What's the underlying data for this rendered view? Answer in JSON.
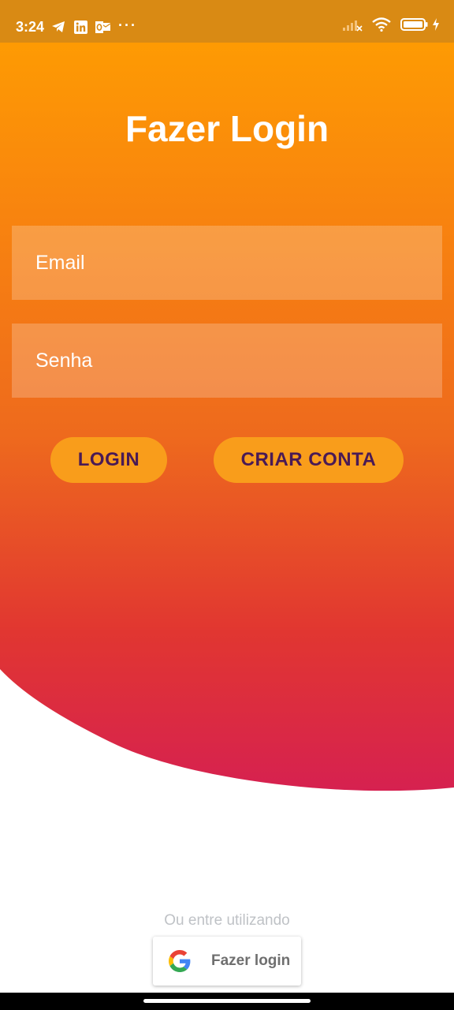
{
  "status_bar": {
    "time": "3:24",
    "left_icons": [
      "telegram-icon",
      "linkedin-icon",
      "outlook-icon"
    ],
    "overflow": "···",
    "right_icons": [
      "signal-icon",
      "wifi-icon",
      "battery-icon",
      "charging-icon"
    ]
  },
  "login": {
    "title": "Fazer Login",
    "email_placeholder": "Email",
    "password_placeholder": "Senha",
    "login_button": "LOGIN",
    "create_account_button": "CRIAR CONTA"
  },
  "social": {
    "or_text": "Ou entre utilizando",
    "google_button": "Fazer login",
    "google_icon": "google-logo-icon"
  },
  "colors": {
    "gradient_top": "#ffa000",
    "gradient_mid": "#f07317",
    "gradient_red": "#e13631",
    "gradient_bottom": "#d62150",
    "button_bg": "#f99d1b",
    "button_text": "#4a1a55",
    "status_bar": "#d98a14"
  }
}
